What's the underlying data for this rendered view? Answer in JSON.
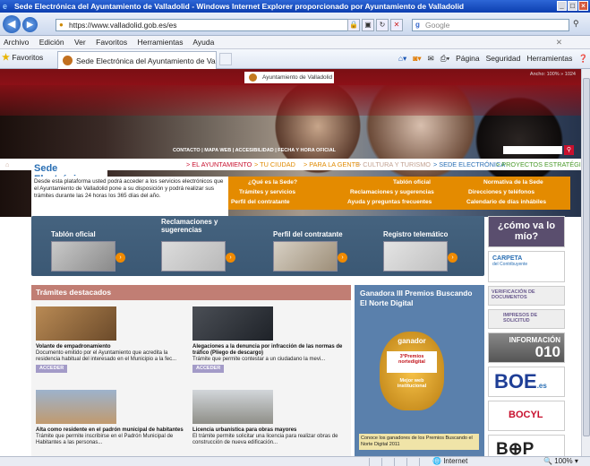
{
  "browser": {
    "title": "Sede Electrónica del Ayuntamiento de Valladolid - Windows Internet Explorer proporcionado por Ayuntamiento de Valladolid",
    "url": "https://www.valladolid.gob.es/es",
    "search_placeholder": "Google",
    "menu": [
      "Archivo",
      "Edición",
      "Ver",
      "Favoritos",
      "Herramientas",
      "Ayuda"
    ],
    "favorites_label": "Favoritos",
    "tab_title": "Sede Electrónica del Ayuntamiento de Va...",
    "commands": [
      "Página",
      "Seguridad",
      "Herramientas"
    ],
    "status_zone": "Internet",
    "zoom": "100%"
  },
  "page": {
    "brand": "Ayuntamiento de Valladolid",
    "ancho": "Ancho: 100% » 1024",
    "toplinks": "CONTACTO  |  MAPA WEB  |  ACCESIBILIDAD  |  FECHA Y HORA OFICIAL",
    "nav": [
      "> EL AYUNTAMIENTO",
      "> TU CIUDAD",
      "> PARA LA GENTE",
      "> CULTURA Y TURISMO",
      "> SEDE ELECTRÓNICA",
      "> PROYECTOS ESTRATÉGICOS"
    ],
    "sede_title": "Sede Electrónica",
    "sede_text": "Desde esta plataforma usted podrá acceder a los servicios electrónicos que el Ayuntamiento de Valladolid pone a su disposición y podrá realizar sus trámites durante las 24 horas los 365 días del año.",
    "quick_links": [
      "¿Qué es la Sede?",
      "Tablón oficial",
      "Normativa de la Sede",
      "Trámites y servicios",
      "Reclamaciones y sugerencias",
      "Direcciones y teléfonos",
      "Perfil del contratante",
      "Ayuda y preguntas frecuentes",
      "Calendario de días inhábiles"
    ],
    "strip": [
      "Tablón oficial",
      "Reclamaciones y sugerencias",
      "Perfil del contratante",
      "Registro telemático"
    ],
    "banners": {
      "como_va": "¿cómo va lo mío?",
      "carpeta": "CARPETA",
      "carpeta_sub": "del Contribuyente",
      "verificacion": "VERIFICACIÓN DE DOCUMENTOS",
      "impresos": "IMPRESOS DE SOLICITUD",
      "informacion": "INFORMACIÓN",
      "info_num": "010",
      "boe": "BOE",
      "boe_sub": ".es",
      "bocyl": "BOCYL",
      "bop": "B⊕P"
    },
    "tramites_title": "Trámites destacados",
    "tramites": [
      {
        "title": "Volante de empadronamiento",
        "text": "Documento emitido por el Ayuntamiento que acredita la residencia habitual del interesado en el Municipio a la fec...",
        "btn": "ACCEDER"
      },
      {
        "title": "Alegaciones a la denuncia por infracción de las normas de tráfico (Pliego de descargo)",
        "text": "Trámite que permite contestar a un ciudadano la mevi...",
        "btn": "ACCEDER"
      },
      {
        "title": "Alta como residente en el padrón municipal de habitantes",
        "text": "Trámite que permite inscribirse en el Padrón Municipal de Habitantes a las personas...",
        "btn": ""
      },
      {
        "title": "Licencia urbanística para obras mayores",
        "text": "El trámite permite solicitar una licencia para realizar obras de construcción de nueva edificación...",
        "btn": ""
      }
    ],
    "ganadora_title": "Ganadora III Premios Buscando El Norte Digital",
    "award_ganador": "ganador",
    "award_brand": "3ªPremios nortedigital",
    "award_mejor": "Mejor web institucional",
    "ganadora_caption": "Conoce los ganadores de los Premios Buscando el Norte Digital 2011"
  }
}
